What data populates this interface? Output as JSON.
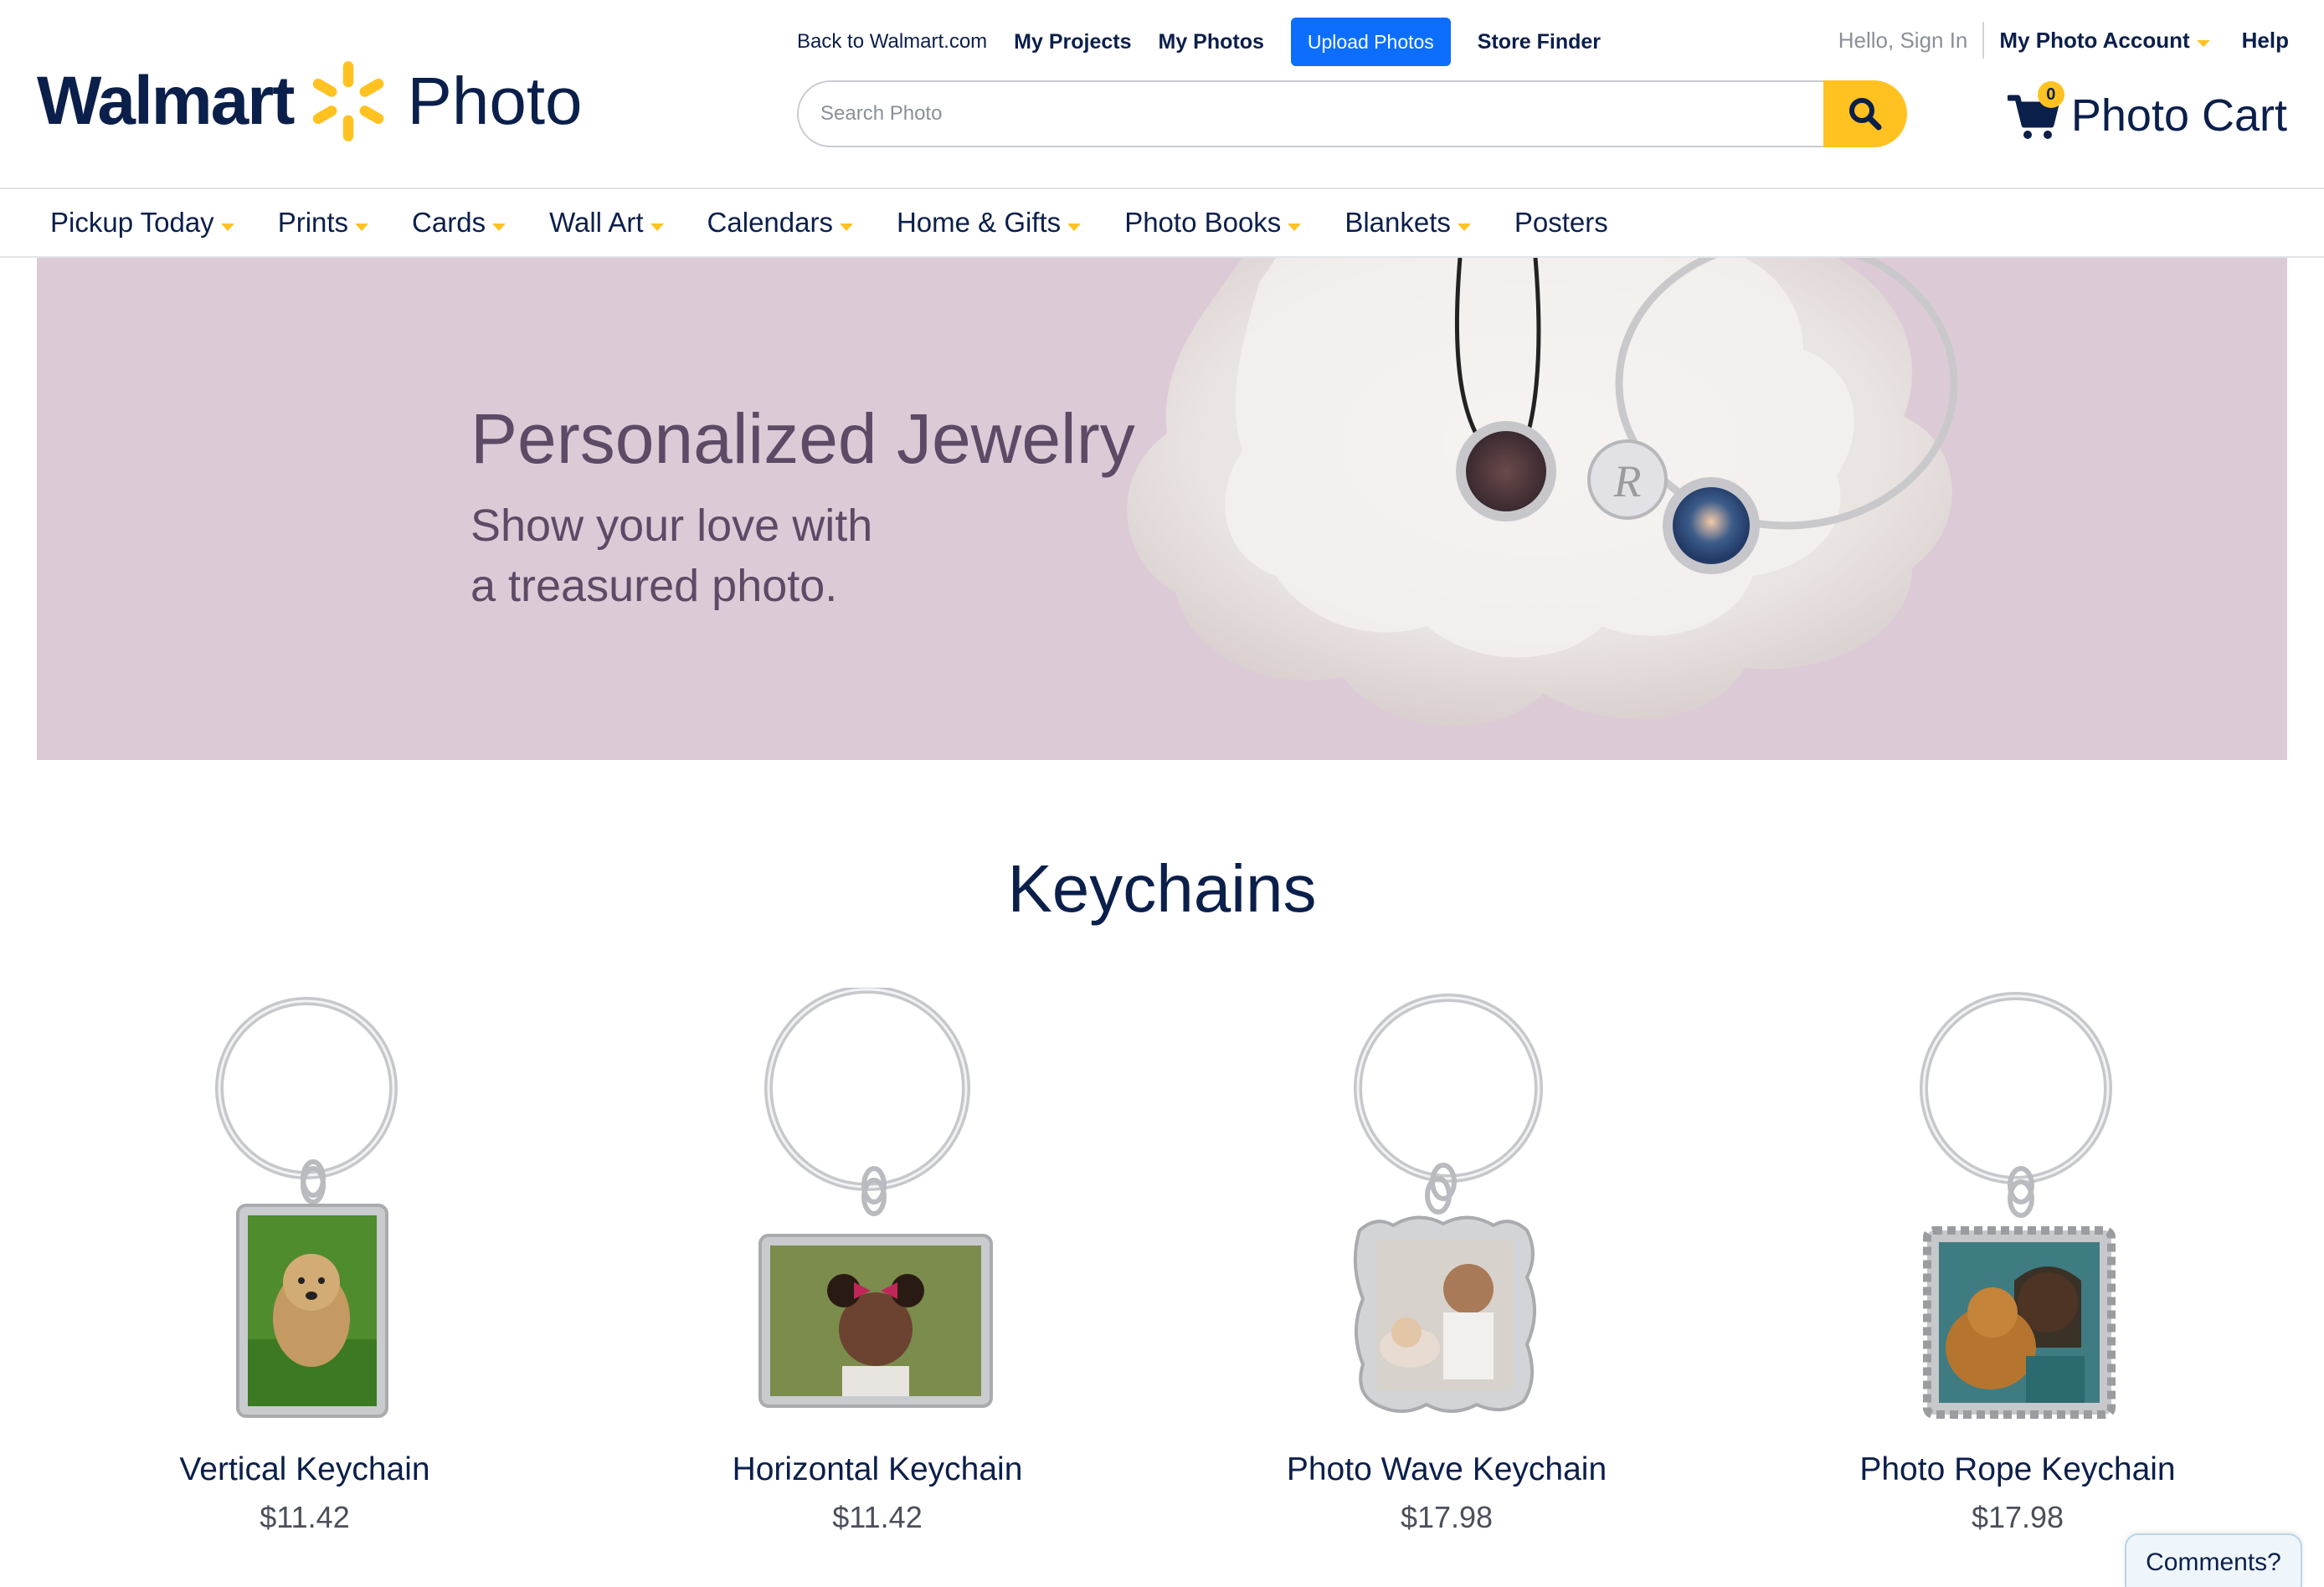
{
  "brand": {
    "wordmark": "Walmart",
    "product": "Photo"
  },
  "top_links": {
    "back": "Back to Walmart.com",
    "projects": "My Projects",
    "photos": "My Photos",
    "upload": "Upload Photos",
    "store_finder": "Store Finder"
  },
  "account": {
    "greeting": "Hello, Sign In",
    "my_account": "My Photo Account",
    "help": "Help"
  },
  "search": {
    "placeholder": "Search Photo"
  },
  "cart": {
    "count": "0",
    "label": "Photo Cart"
  },
  "nav": {
    "items": [
      {
        "label": "Pickup Today",
        "dropdown": true
      },
      {
        "label": "Prints",
        "dropdown": true
      },
      {
        "label": "Cards",
        "dropdown": true
      },
      {
        "label": "Wall Art",
        "dropdown": true
      },
      {
        "label": "Calendars",
        "dropdown": true
      },
      {
        "label": "Home & Gifts",
        "dropdown": true
      },
      {
        "label": "Photo Books",
        "dropdown": true
      },
      {
        "label": "Blankets",
        "dropdown": true
      },
      {
        "label": "Posters",
        "dropdown": false
      }
    ]
  },
  "hero": {
    "title": "Personalized Jewelry",
    "subtitle_line1": "Show your love with",
    "subtitle_line2": "a treasured photo."
  },
  "section": {
    "title": "Keychains"
  },
  "products": [
    {
      "name": "Vertical Keychain",
      "price": "$11.42",
      "photo": "dog"
    },
    {
      "name": "Horizontal Keychain",
      "price": "$11.42",
      "photo": "girl"
    },
    {
      "name": "Photo Wave Keychain",
      "price": "$17.98",
      "photo": "siblings"
    },
    {
      "name": "Photo Rope Keychain",
      "price": "$17.98",
      "photo": "girl-with-dog"
    }
  ],
  "feedback": {
    "label": "Comments?"
  },
  "colors": {
    "brand_navy": "#0b1f4b",
    "spark_yellow": "#ffc220",
    "upload_blue": "#0d6efd",
    "hero_bg": "#dccbd6"
  }
}
